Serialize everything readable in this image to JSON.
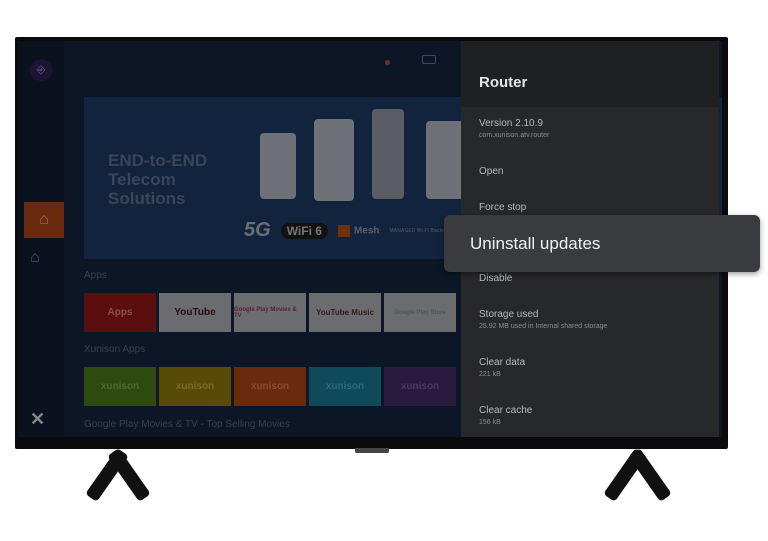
{
  "launcher": {
    "banner_text": "END-to-END Telecom Solutions",
    "badges": {
      "fiveg": "5G",
      "wifi": "WiFi 6",
      "mesh": "Mesh",
      "managed": "MANAGED Wi-Fi Backend"
    },
    "sections": [
      "Apps",
      "Xunison Apps",
      "Google Play Movies & TV  -  Top Selling Movies"
    ],
    "apps": [
      {
        "label": "Apps",
        "color": "#5a0e0e",
        "text": "#8a5050"
      },
      {
        "label": "YouTube",
        "color": "#6a6c70",
        "text": "#2a0a0a"
      },
      {
        "label": "Google Play Movies & TV",
        "color": "#6a6c70",
        "text": "#5a2030"
      },
      {
        "label": "YouTube Music",
        "color": "#6a6c70",
        "text": "#3a1a1a"
      },
      {
        "label": "Google Play Store",
        "color": "#6a6c70",
        "text": "#4a5a5a"
      }
    ],
    "xunison_apps": [
      {
        "label": "xunison",
        "color": "#2f4a10"
      },
      {
        "label": "xunison",
        "color": "#5a4a08"
      },
      {
        "label": "xunison",
        "color": "#6a2a0e"
      },
      {
        "label": "xunison",
        "color": "#0e4a5a"
      },
      {
        "label": "xunison",
        "color": "#2a1a40"
      }
    ]
  },
  "panel": {
    "title": "Router",
    "version": "Version 2.10.9",
    "package": "com.xunison.atv.router",
    "open": "Open",
    "force_stop": "Force stop",
    "disable": "Disable",
    "storage_label": "Storage used",
    "storage_value": "25.92 MB used in Internal shared storage",
    "clear_data_label": "Clear data",
    "clear_data_value": "221 kB",
    "clear_cache_label": "Clear cache",
    "clear_cache_value": "156 kB"
  },
  "popup": {
    "label": "Uninstall updates"
  }
}
